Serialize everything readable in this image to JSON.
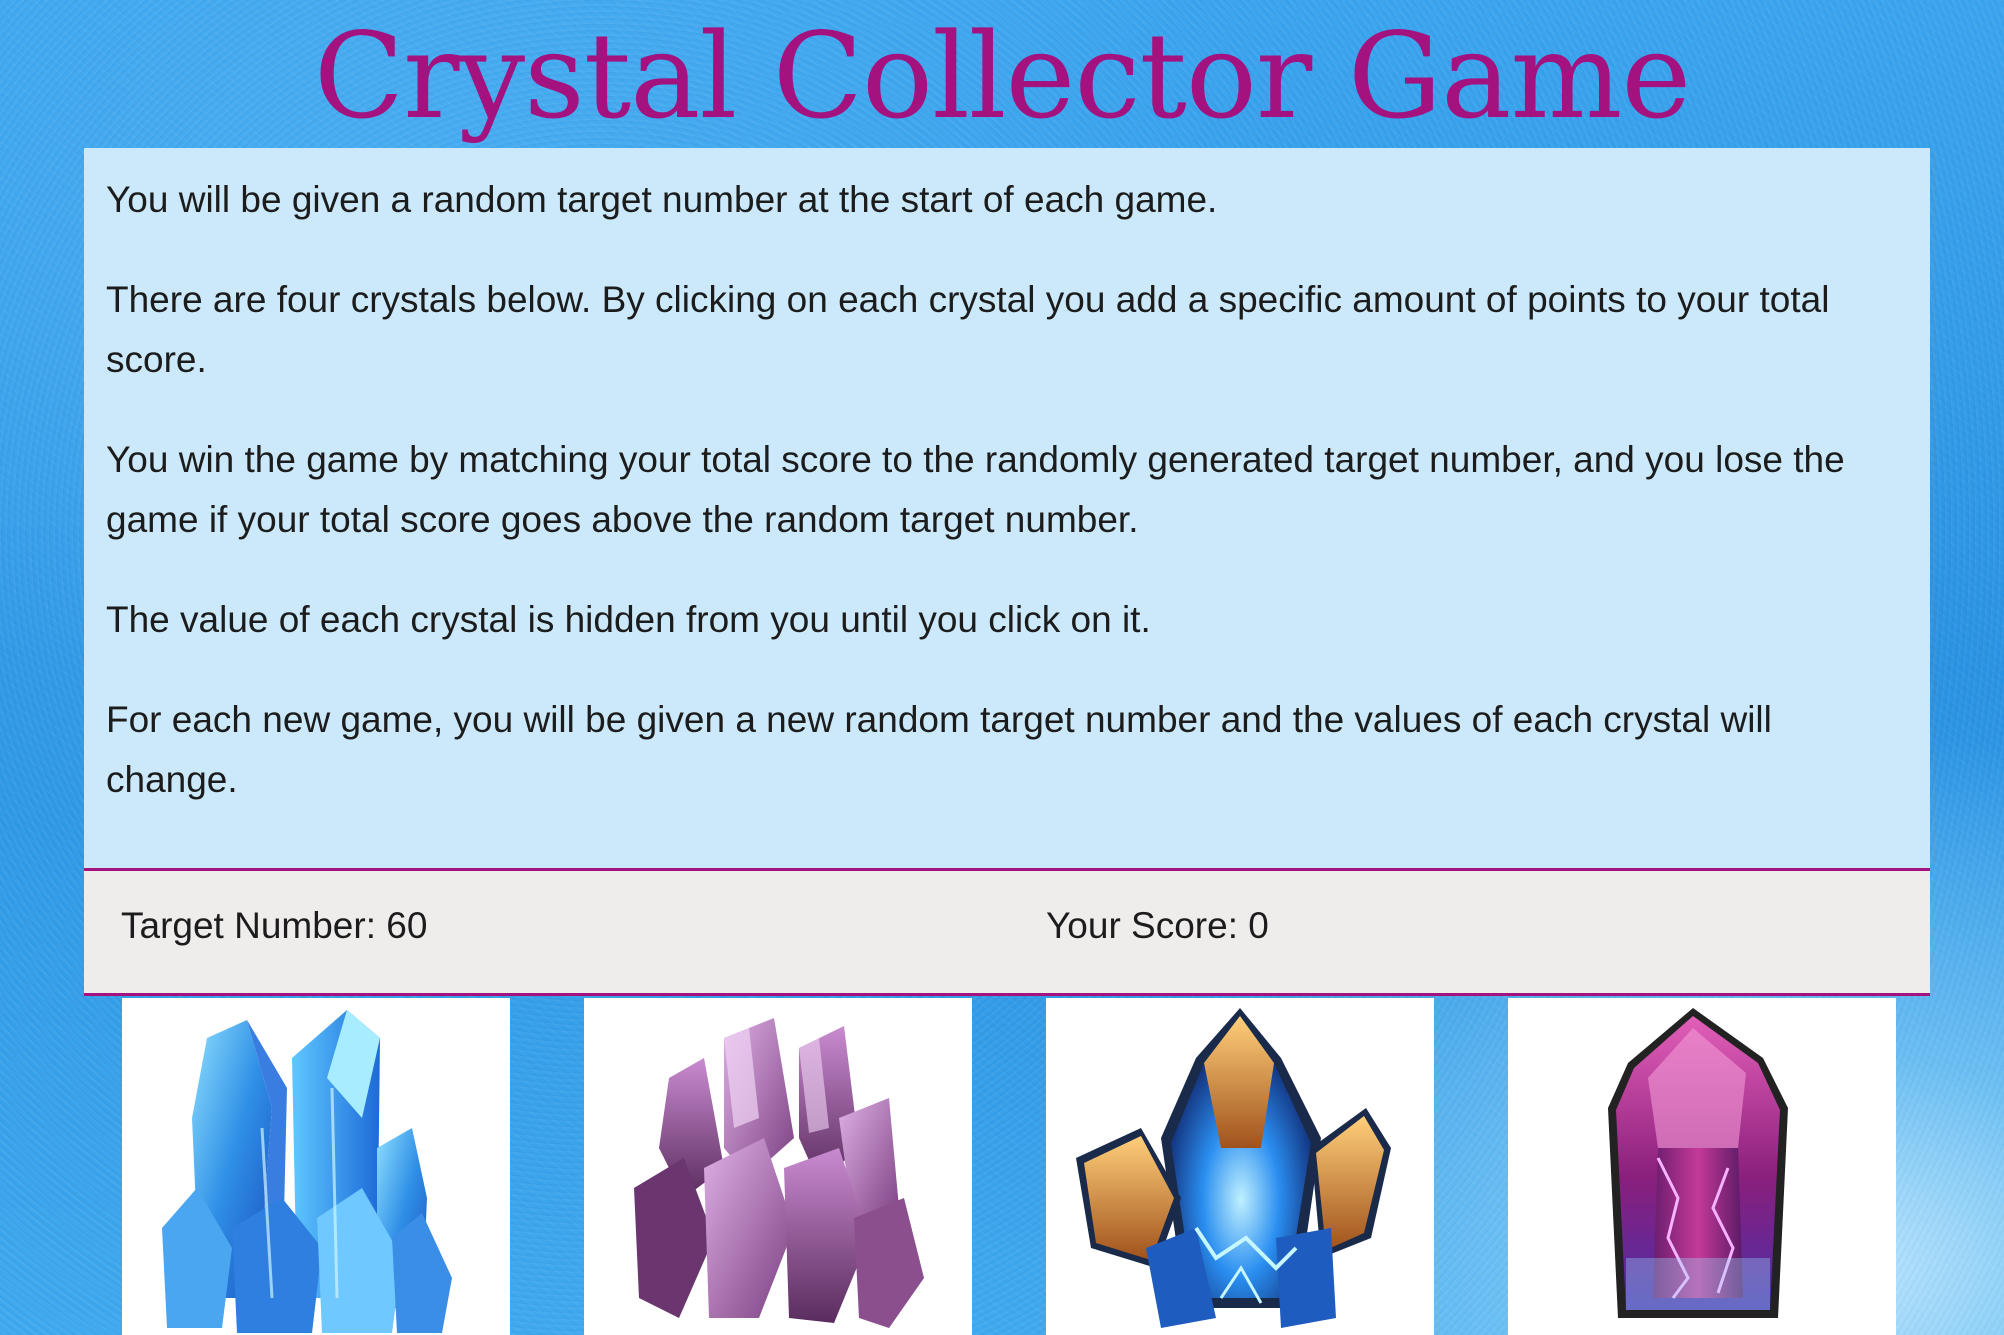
{
  "header": {
    "title": "Crystal Collector Game"
  },
  "rules": {
    "paragraphs": [
      "You will be given a random target number at the start of each game.",
      "There are four crystals below. By clicking on each crystal you add a specific amount of points to your total score.",
      "You win the game by matching your total score to the randomly generated target number, and you lose the game if your total score goes above the random target number.",
      "The value of each crystal is hidden from you until you click on it.",
      "For each new game, you will be given a new random target number and the values of each crystal will change."
    ]
  },
  "scoreboard": {
    "target_text": "Target Number: 60",
    "score_text": "Your Score: 0"
  },
  "crystals": [
    {
      "icon": "blue-crystal-cluster-icon",
      "color": "#2e8ee8"
    },
    {
      "icon": "purple-crystal-cluster-icon",
      "color": "#8a4f8c"
    },
    {
      "icon": "orange-blue-crystal-icon",
      "color": "#e8903a"
    },
    {
      "icon": "magenta-crystal-icon",
      "color": "#b0247e"
    }
  ],
  "colors": {
    "accent": "#a4127f",
    "rules_bg": "#cbe9fa",
    "scorebar_bg": "#efecec",
    "page_bg": "#2f9ae8"
  }
}
